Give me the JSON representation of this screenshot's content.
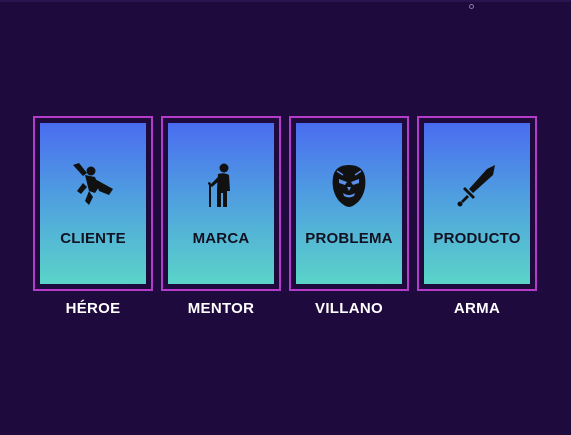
{
  "cards": [
    {
      "title": "CLIENTE",
      "icon": "superhero-icon",
      "role": "HÉROE"
    },
    {
      "title": "MARCA",
      "icon": "elder-with-cane-icon",
      "role": "MENTOR"
    },
    {
      "title": "PROBLEMA",
      "icon": "demon-mask-icon",
      "role": "VILLANO"
    },
    {
      "title": "PRODUCTO",
      "icon": "sword-icon",
      "role": "ARMA"
    }
  ],
  "colors": {
    "background": "#1e0a3c",
    "frame_border": "#b43cc8",
    "card_gradient_top": "#4a6cf0",
    "card_gradient_bottom": "#5bd4c8",
    "card_text": "#111122",
    "role_text": "#ffffff"
  }
}
